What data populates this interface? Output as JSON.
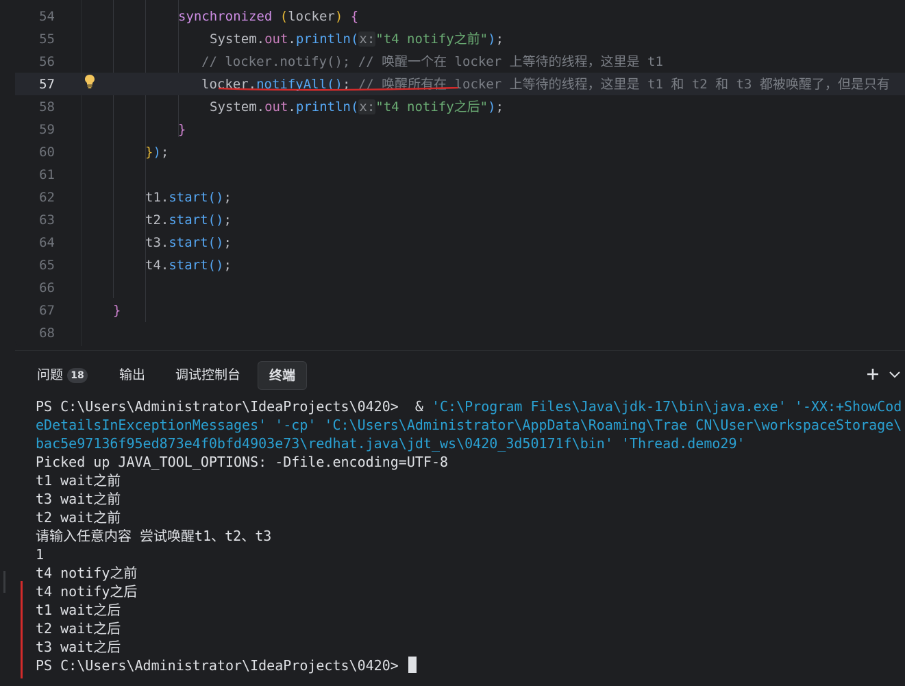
{
  "editor": {
    "current_line": 57,
    "lines": [
      {
        "num": "54",
        "indent": 238,
        "tokens": [
          [
            "kw",
            "synchronized"
          ],
          [
            "var",
            " "
          ],
          [
            "br-y",
            "("
          ],
          [
            "var",
            "locker"
          ],
          [
            "br-y",
            ")"
          ],
          [
            "var",
            " "
          ],
          [
            "br-p",
            "{"
          ]
        ]
      },
      {
        "num": "55",
        "indent": 284,
        "tokens": [
          [
            "cls",
            "System"
          ],
          [
            "var",
            "."
          ],
          [
            "fld",
            "out"
          ],
          [
            "var",
            "."
          ],
          [
            "fn",
            "println"
          ],
          [
            "br-b",
            "("
          ],
          [
            "hint",
            "x:"
          ],
          [
            "str",
            "\"t4 notify之前\""
          ],
          [
            "br-b",
            ")"
          ],
          [
            "var",
            ";"
          ]
        ]
      },
      {
        "num": "56",
        "indent": 272,
        "tokens": [
          [
            "cmt",
            "// locker.notify(); // 唤醒一个在 locker 上等待的线程，这里是 t1"
          ]
        ]
      },
      {
        "num": "57",
        "indent": 272,
        "tokens": [
          [
            "var",
            "locker"
          ],
          [
            "var",
            "."
          ],
          [
            "fn",
            "notifyAll"
          ],
          [
            "br-b",
            "()"
          ],
          [
            "var",
            "; "
          ],
          [
            "cmt",
            "// 唤醒所有在 locker 上等待的线程，这里是 t1 和 t2 和 t3 都被唤醒了，但是只有"
          ]
        ]
      },
      {
        "num": "58",
        "indent": 284,
        "tokens": [
          [
            "cls",
            "System"
          ],
          [
            "var",
            "."
          ],
          [
            "fld",
            "out"
          ],
          [
            "var",
            "."
          ],
          [
            "fn",
            "println"
          ],
          [
            "br-b",
            "("
          ],
          [
            "hint",
            "x:"
          ],
          [
            "str",
            "\"t4 notify之后\""
          ],
          [
            "br-b",
            ")"
          ],
          [
            "var",
            ";"
          ]
        ]
      },
      {
        "num": "59",
        "indent": 238,
        "tokens": [
          [
            "br-p",
            "}"
          ]
        ]
      },
      {
        "num": "60",
        "indent": 190,
        "tokens": [
          [
            "br-y",
            "}"
          ],
          [
            "br-b",
            ")"
          ],
          [
            "var",
            ";"
          ]
        ]
      },
      {
        "num": "61",
        "indent": 190,
        "tokens": []
      },
      {
        "num": "62",
        "indent": 190,
        "tokens": [
          [
            "var",
            "t1"
          ],
          [
            "var",
            "."
          ],
          [
            "fn",
            "start"
          ],
          [
            "br-b",
            "()"
          ],
          [
            "var",
            ";"
          ]
        ]
      },
      {
        "num": "63",
        "indent": 190,
        "tokens": [
          [
            "var",
            "t2"
          ],
          [
            "var",
            "."
          ],
          [
            "fn",
            "start"
          ],
          [
            "br-b",
            "()"
          ],
          [
            "var",
            ";"
          ]
        ]
      },
      {
        "num": "64",
        "indent": 190,
        "tokens": [
          [
            "var",
            "t3"
          ],
          [
            "var",
            "."
          ],
          [
            "fn",
            "start"
          ],
          [
            "br-b",
            "()"
          ],
          [
            "var",
            ";"
          ]
        ]
      },
      {
        "num": "65",
        "indent": 190,
        "tokens": [
          [
            "var",
            "t4"
          ],
          [
            "var",
            "."
          ],
          [
            "fn",
            "start"
          ],
          [
            "br-b",
            "()"
          ],
          [
            "var",
            ";"
          ]
        ]
      },
      {
        "num": "66",
        "indent": 190,
        "tokens": []
      },
      {
        "num": "67",
        "indent": 143,
        "tokens": [
          [
            "br-p",
            "}"
          ]
        ]
      },
      {
        "num": "68",
        "indent": 143,
        "tokens": []
      }
    ],
    "intention_icon": "lightbulb-icon"
  },
  "panel": {
    "tabs": [
      {
        "label": "问题",
        "badge": "18",
        "active": false
      },
      {
        "label": "输出",
        "badge": "",
        "active": false
      },
      {
        "label": "调试控制台",
        "badge": "",
        "active": false
      },
      {
        "label": "终端",
        "badge": "",
        "active": true
      }
    ],
    "tools": {
      "add_icon": "plus-icon",
      "menu_icon": "chevron-down-icon"
    }
  },
  "terminal": {
    "lines": [
      [
        [
          "t-cmd",
          "PS C:\\Users\\Administrator\\IdeaProjects\\0420>  & "
        ],
        [
          "t-cyan",
          "'C:\\Program Files\\Java\\jdk-17\\bin\\java.exe' '-XX:+ShowCod"
        ]
      ],
      [
        [
          "t-cyan",
          "eDetailsInExceptionMessages' '-cp' 'C:\\Users\\Administrator\\AppData\\Roaming\\Trae CN\\User\\workspaceStorage\\"
        ]
      ],
      [
        [
          "t-cyan",
          "bac5e97136f95ed873e4f0bfd4903e73\\redhat.java\\jdt_ws\\0420_3d50171f\\bin' 'Thread.demo29'"
        ]
      ],
      [
        [
          "t-cmd",
          "Picked up JAVA_TOOL_OPTIONS: -Dfile.encoding=UTF-8"
        ]
      ],
      [
        [
          "t-cmd",
          "t1 wait之前"
        ]
      ],
      [
        [
          "t-cmd",
          "t3 wait之前"
        ]
      ],
      [
        [
          "t-cmd",
          "t2 wait之前"
        ]
      ],
      [
        [
          "t-cmd",
          "请输入任意内容 尝试唤醒t1、t2、t3"
        ]
      ],
      [
        [
          "t-cmd",
          "1"
        ]
      ],
      [
        [
          "t-cmd",
          "t4 notify之前"
        ]
      ],
      [
        [
          "t-cmd",
          "t4 notify之后"
        ]
      ],
      [
        [
          "t-cmd",
          "t1 wait之后"
        ]
      ],
      [
        [
          "t-cmd",
          "t2 wait之后"
        ]
      ],
      [
        [
          "t-cmd",
          "t3 wait之后"
        ]
      ],
      [
        [
          "t-cmd",
          "PS C:\\Users\\Administrator\\IdeaProjects\\0420> "
        ]
      ]
    ]
  },
  "colors": {
    "annotation_underline": "#d22b2b",
    "marker_bar": "#d22b2b"
  }
}
